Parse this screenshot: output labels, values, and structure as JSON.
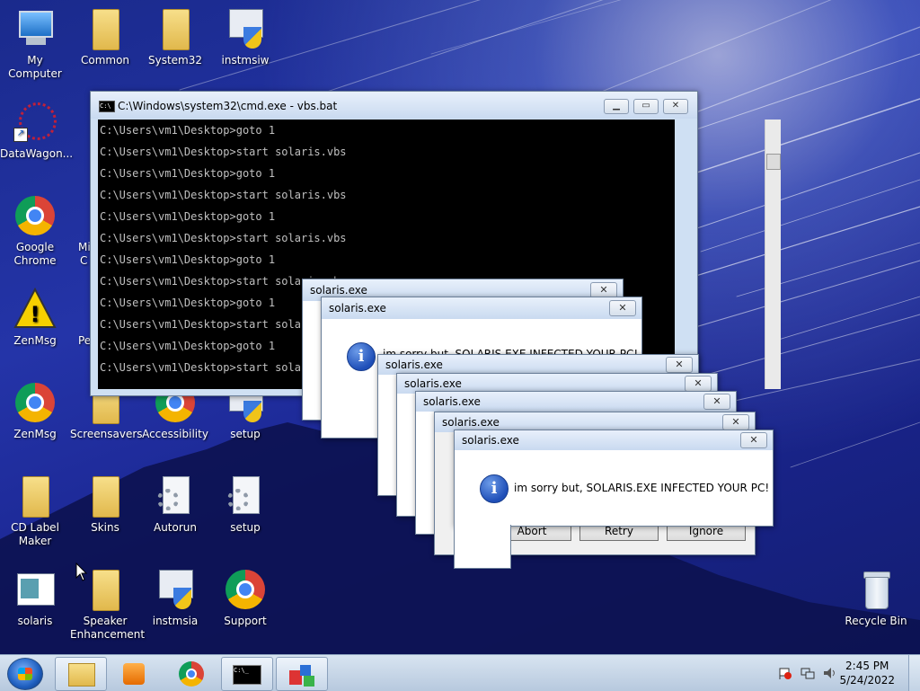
{
  "desktop_icons": [
    {
      "label": "My Computer",
      "icon": "computer-icon"
    },
    {
      "label": "Common",
      "icon": "folder-icon"
    },
    {
      "label": "System32",
      "icon": "folder-icon"
    },
    {
      "label": "instmsiw",
      "icon": "installer-icon"
    },
    {
      "label": "DataWagon...",
      "icon": "datawagon-icon"
    },
    {
      "label": "Google Chrome",
      "icon": "chrome-icon"
    },
    {
      "label": "ZenMsg",
      "icon": "warning-icon"
    },
    {
      "label": "ZenMsg",
      "icon": "chrome-icon"
    },
    {
      "label": "Screensavers",
      "icon": "folder-icon"
    },
    {
      "label": "Accessibility",
      "icon": "chrome-icon"
    },
    {
      "label": "setup",
      "icon": "installer-icon"
    },
    {
      "label": "CD Label Maker",
      "icon": "folder-icon"
    },
    {
      "label": "Skins",
      "icon": "folder-icon"
    },
    {
      "label": "Autorun",
      "icon": "gear-file-icon"
    },
    {
      "label": "setup",
      "icon": "gear-file-icon"
    },
    {
      "label": "solaris",
      "icon": "window-app-icon"
    },
    {
      "label": "Speaker Enhancement",
      "icon": "folder-icon"
    },
    {
      "label": "instmsia",
      "icon": "installer-icon"
    },
    {
      "label": "Support",
      "icon": "chrome-icon"
    },
    {
      "label": "Recycle Bin",
      "icon": "recycle-bin-icon"
    }
  ],
  "partial_labels": {
    "mi": "Mi",
    "c": "C",
    "pe": "Pe"
  },
  "cmd": {
    "title": "C:\\Windows\\system32\\cmd.exe - vbs.bat",
    "lines": [
      "C:\\Users\\vm1\\Desktop>goto 1",
      "C:\\Users\\vm1\\Desktop>start solaris.vbs",
      "C:\\Users\\vm1\\Desktop>goto 1",
      "C:\\Users\\vm1\\Desktop>start solaris.vbs",
      "C:\\Users\\vm1\\Desktop>goto 1",
      "C:\\Users\\vm1\\Desktop>start solaris.vbs",
      "C:\\Users\\vm1\\Desktop>goto 1",
      "C:\\Users\\vm1\\Desktop>start solaris.vbs",
      "C:\\Users\\vm1\\Desktop>goto 1",
      "C:\\Users\\vm1\\Desktop>start solaris.vbs",
      "C:\\Users\\vm1\\Desktop>goto 1",
      "C:\\Users\\vm1\\Desktop>start solaris.vbs"
    ]
  },
  "dialog": {
    "title": "solaris.exe",
    "message": "im sorry but, SOLARIS.EXE INFECTED YOUR PC!",
    "partial_message": "im sorry but, SOLARIS.EXE INFECTED YOUR PC!",
    "close": "✕",
    "buttons": {
      "abort": "Abort",
      "retry": "Retry",
      "ignore": "Ignore"
    }
  },
  "taskbar": {
    "time": "2:45 PM",
    "date": "5/24/2022"
  }
}
